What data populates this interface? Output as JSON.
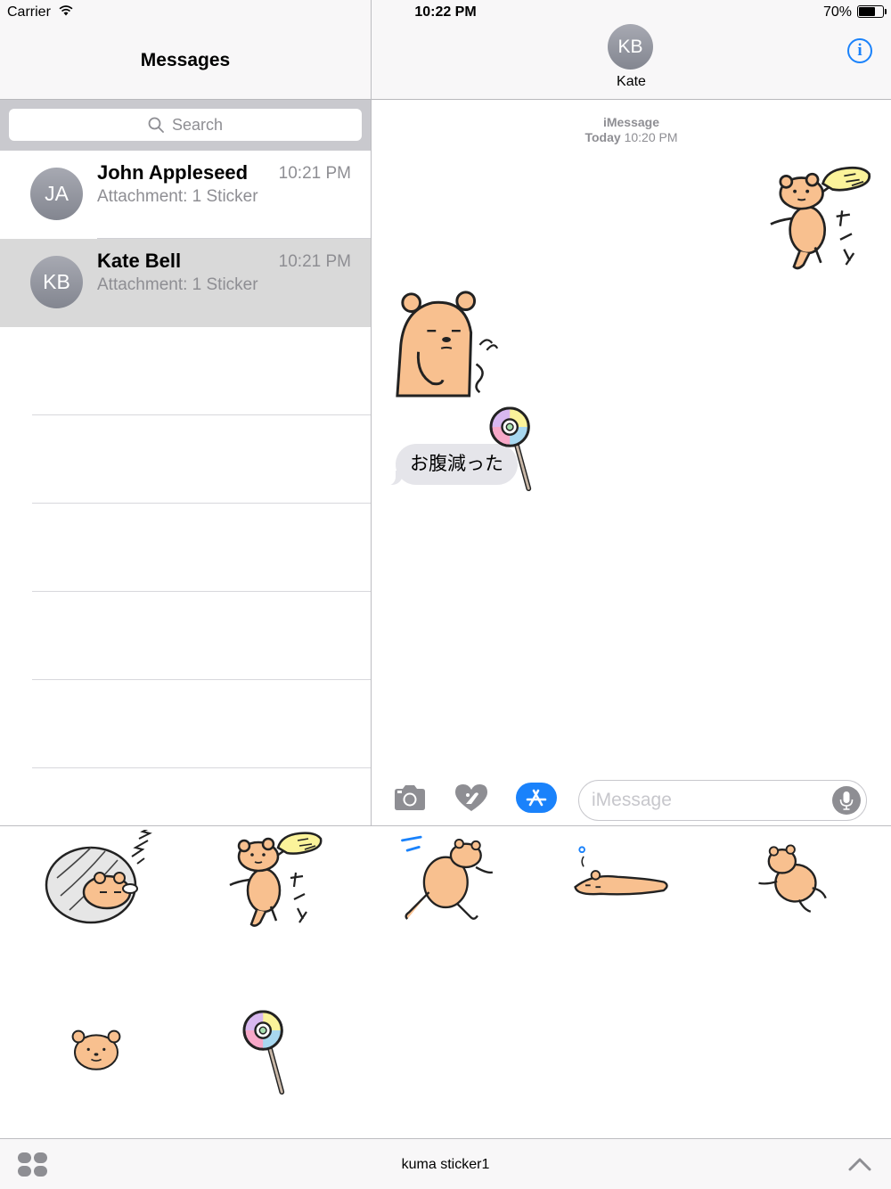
{
  "status_bar": {
    "carrier": "Carrier",
    "time": "10:22 PM",
    "battery_percent": "70%",
    "battery_level": 0.7
  },
  "left_pane": {
    "title": "Messages",
    "search_placeholder": "Search",
    "conversations": [
      {
        "initials": "JA",
        "name": "John Appleseed",
        "time": "10:21 PM",
        "preview": "Attachment: 1 Sticker",
        "selected": false
      },
      {
        "initials": "KB",
        "name": "Kate Bell",
        "time": "10:21 PM",
        "preview": "Attachment: 1 Sticker",
        "selected": true
      }
    ]
  },
  "conversation": {
    "contact_initials": "KB",
    "contact_name": "Kate",
    "service": "iMessage",
    "timestamp_day": "Today",
    "timestamp_time": "10:20 PM",
    "messages": [
      {
        "type": "sticker",
        "from": "me",
        "sticker": "bear-reaching-naan"
      },
      {
        "type": "sticker",
        "from": "them",
        "sticker": "bear-tummy-rumble"
      },
      {
        "type": "text",
        "from": "them",
        "text": "お腹減った"
      },
      {
        "type": "sticker",
        "from": "them",
        "sticker": "lollipop"
      }
    ]
  },
  "input_bar": {
    "placeholder": "iMessage",
    "value": ""
  },
  "sticker_drawer": {
    "app_name": "kuma sticker1",
    "stickers": [
      "bear-sleeping-clam-shell",
      "bear-reaching-naan",
      "bear-running",
      "bear-lying-down",
      "bear-rolling",
      "bear-face",
      "lollipop"
    ]
  },
  "colors": {
    "accent": "#1a82fb",
    "bear": "#f8c08f",
    "bubble": "#e5e5ea",
    "selected_row": "#d9d9d9"
  }
}
